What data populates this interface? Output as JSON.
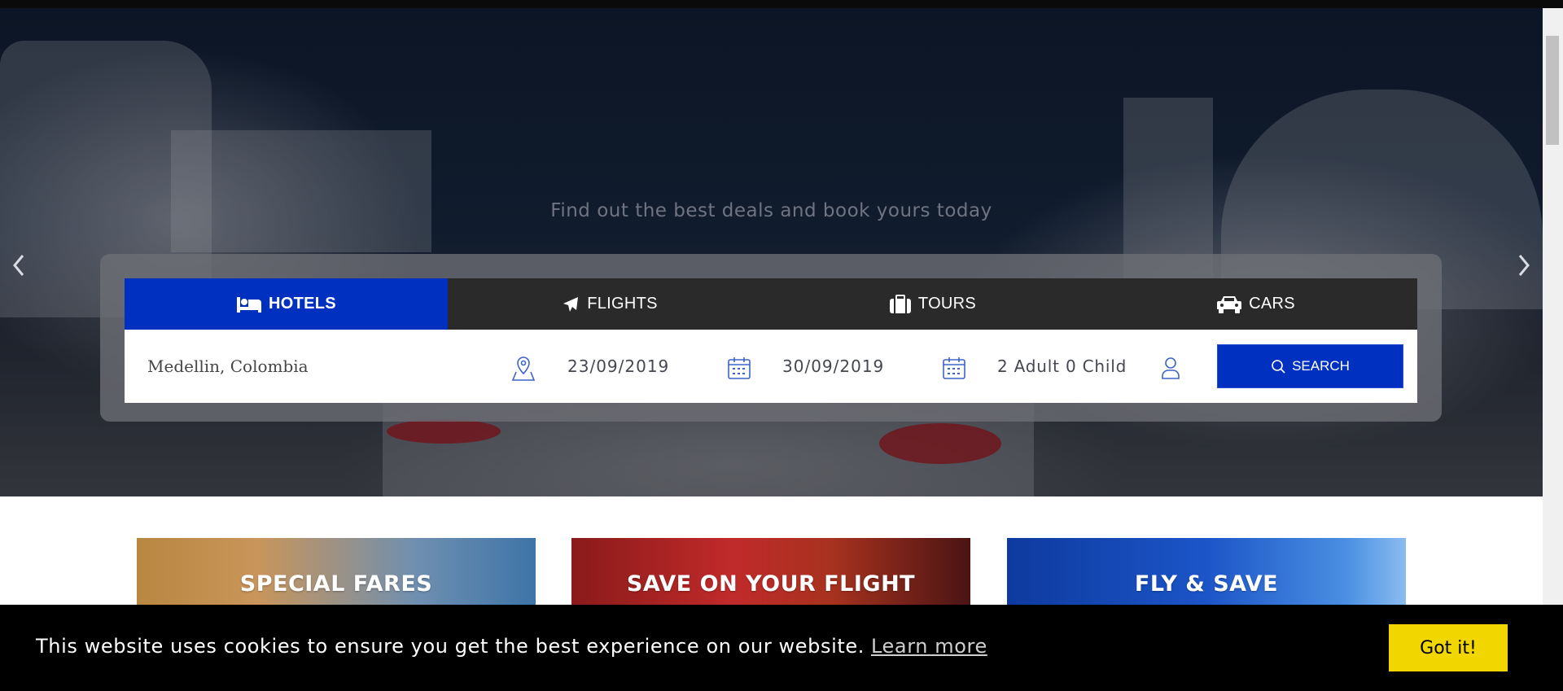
{
  "hero": {
    "tagline": "Find out the best deals and book yours today",
    "prev_arrow": "‹",
    "next_arrow": "›"
  },
  "search": {
    "tabs": [
      {
        "label": "HOTELS",
        "icon": "bed-icon",
        "active": true
      },
      {
        "label": "FLIGHTS",
        "icon": "plane-icon",
        "active": false
      },
      {
        "label": "TOURS",
        "icon": "suitcase-icon",
        "active": false
      },
      {
        "label": "CARS",
        "icon": "car-icon",
        "active": false
      }
    ],
    "location": "Medellin, Colombia",
    "checkin": "23/09/2019",
    "checkout": "30/09/2019",
    "guests": "2 Adult 0 Child",
    "button_label": "SEARCH",
    "accent_color": "#0030c0"
  },
  "promos": [
    {
      "title": "SPECIAL FARES"
    },
    {
      "title": "SAVE ON YOUR FLIGHT"
    },
    {
      "title": "FLY & SAVE"
    }
  ],
  "cookie": {
    "message": "This website uses cookies to ensure you get the best experience on our website.",
    "link_label": "Learn more",
    "button_label": "Got it!",
    "button_color": "#f1d600"
  }
}
